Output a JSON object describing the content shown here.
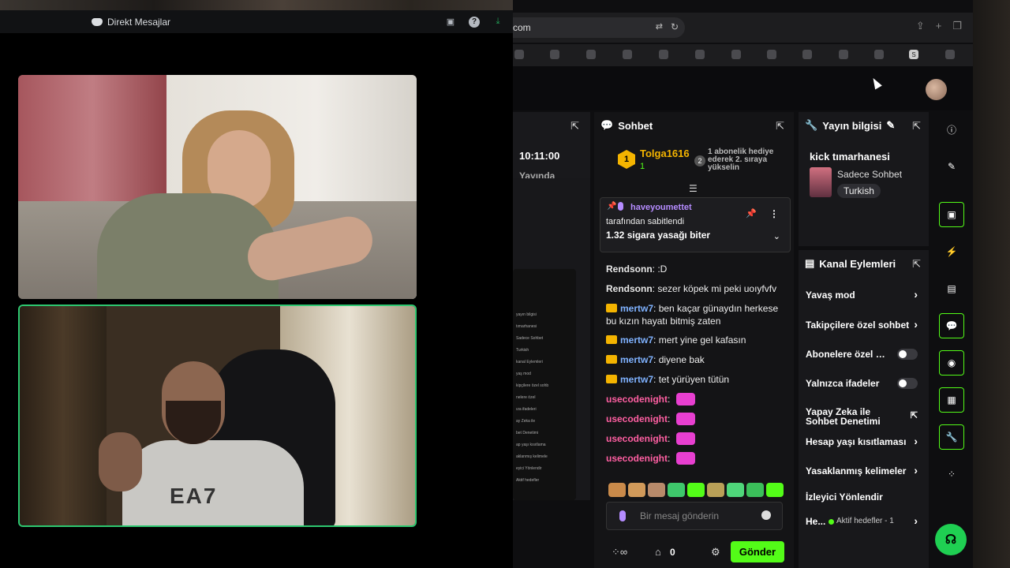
{
  "discord": {
    "title": "Direkt Mesajlar",
    "icons": [
      "screen-share-icon",
      "help-icon",
      "download-icon"
    ]
  },
  "browser": {
    "url": "com",
    "bookmark_letter": "S"
  },
  "left_panel": {
    "time": "10:11:00",
    "live_label": "Yayında",
    "mini_items": [
      "yayın bilgisi",
      "tımarhanesi",
      "Sadece Sohbet",
      "Turkish",
      "kanal Eylemleri",
      "yaş mod",
      "kipçilere özel sohb",
      "nelere özel",
      "ıza ifadeleri",
      "ay Zeka ile",
      "bet Denetimi",
      "ap yaşı kısıtlama",
      "aklanmış kelimele",
      "eyici Yönlendir",
      "Aktif hedefler"
    ]
  },
  "chat": {
    "header": "Sohbet",
    "gift_rank_badge": "1",
    "gift_user": "Tolga1616",
    "gift_count": "1",
    "gift_rank": "2",
    "gift_text": "1 abonelik hediye ederek 2. sıraya yükselin",
    "pinned": {
      "user": "haveyoumettet",
      "by_label": "tarafından sabitlendi",
      "message": "1.32 sigara yasağı biter"
    },
    "messages": [
      {
        "user": "Rendsonn",
        "text": ":D",
        "color": "#e8e8e8",
        "crown": false,
        "emote": false
      },
      {
        "user": "Rendsonn",
        "text": "sezer köpek mi peki uoıyfvfv",
        "color": "#e8e8e8",
        "crown": false,
        "emote": false
      },
      {
        "user": "mertw7",
        "text": "ben kaçar günaydın herkese bu kızın hayatı bitmiş zaten",
        "color": "#7fb2ff",
        "crown": true,
        "emote": false
      },
      {
        "user": "mertw7",
        "text": "mert yine gel kafasın",
        "color": "#7fb2ff",
        "crown": true,
        "emote": false
      },
      {
        "user": "mertw7",
        "text": "diyene bak",
        "color": "#7fb2ff",
        "crown": true,
        "emote": false
      },
      {
        "user": "mertw7",
        "text": "tet yürüyen tütün",
        "color": "#7fb2ff",
        "crown": true,
        "emote": false
      },
      {
        "user": "usecodenight",
        "text": "",
        "color": "#ff5fa2",
        "crown": false,
        "emote": true
      },
      {
        "user": "usecodenight",
        "text": "",
        "color": "#ff5fa2",
        "crown": false,
        "emote": true
      },
      {
        "user": "usecodenight",
        "text": "",
        "color": "#ff5fa2",
        "crown": false,
        "emote": true
      },
      {
        "user": "usecodenight",
        "text": "",
        "color": "#ff5fa2",
        "crown": false,
        "emote": true
      }
    ],
    "input_placeholder": "Bir mesaj gönderin",
    "points": "0",
    "send_label": "Gönder"
  },
  "stream_info": {
    "header": "Yayın bilgisi",
    "title": "kick tımarhanesi",
    "category": "Sadece Sohbet",
    "language": "Turkish"
  },
  "channel_actions": {
    "header": "Kanal Eylemleri",
    "items": [
      {
        "label": "Yavaş mod",
        "control": "chevron"
      },
      {
        "label": "Takipçilere özel sohbet",
        "control": "chevron"
      },
      {
        "label": "Abonelere özel sohbet",
        "control": "toggle"
      },
      {
        "label": "Yalnızca ifadeler",
        "control": "toggle"
      },
      {
        "label": "Yapay Zeka ile Sohbet Denetimi",
        "control": "external"
      },
      {
        "label": "Hesap yaşı kısıtlaması",
        "control": "chevron"
      },
      {
        "label": "Yasaklanmış kelimeler",
        "control": "chevron"
      },
      {
        "label": "İzleyici Yönlendir",
        "control": "none"
      },
      {
        "label": "He...",
        "control": "chevron"
      }
    ],
    "active_goals": "Aktif hedefler - 1"
  },
  "colors": {
    "accent": "#53fc18",
    "discord_border": "#2dc770"
  }
}
